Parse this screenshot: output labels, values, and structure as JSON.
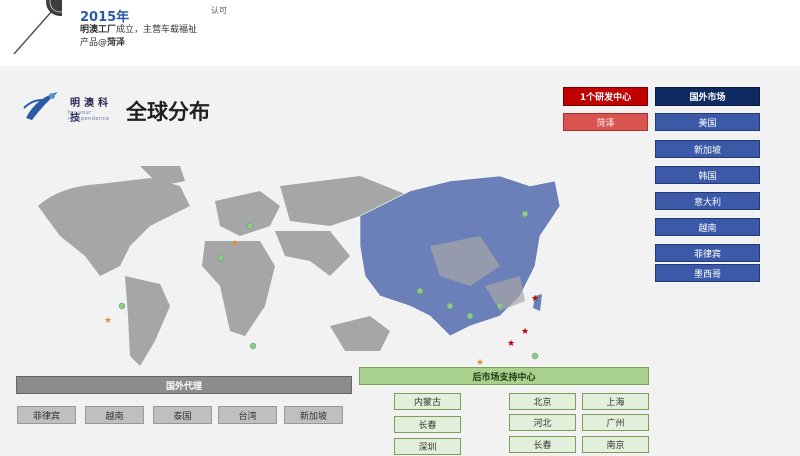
{
  "timeline": {
    "year": "2015年",
    "desc_prefix": "明澳工厂",
    "desc_mid": "成立，主营车载福祉产品@",
    "desc_place": "菏泽",
    "note": "认可"
  },
  "logo": {
    "name": "明澳科技",
    "tagline": "for your independence"
  },
  "title": "全球分布",
  "rd": {
    "header": "1个研发中心",
    "items": [
      "菏泽"
    ]
  },
  "overseas": {
    "header": "国外市场",
    "items": [
      "美国",
      "新加坡",
      "韩国",
      "意大利",
      "越南",
      "菲律宾",
      "墨西哥"
    ]
  },
  "agents": {
    "header": "国外代理",
    "items": [
      "菲律宾",
      "越南",
      "泰国",
      "台湾",
      "新加坡"
    ]
  },
  "aftermarket": {
    "header": "后市场支持中心",
    "col1": [
      "内蒙古",
      "长春",
      "深圳"
    ],
    "col2": [
      "北京",
      "河北",
      "长春"
    ],
    "col3": [
      "上海",
      "广州",
      "南京"
    ]
  },
  "colors": {
    "china": "#6b80b8",
    "world": "#a6a6a6",
    "pin": "#8fc98f",
    "star_red": "#c00000",
    "star_orange": "#e69138"
  }
}
